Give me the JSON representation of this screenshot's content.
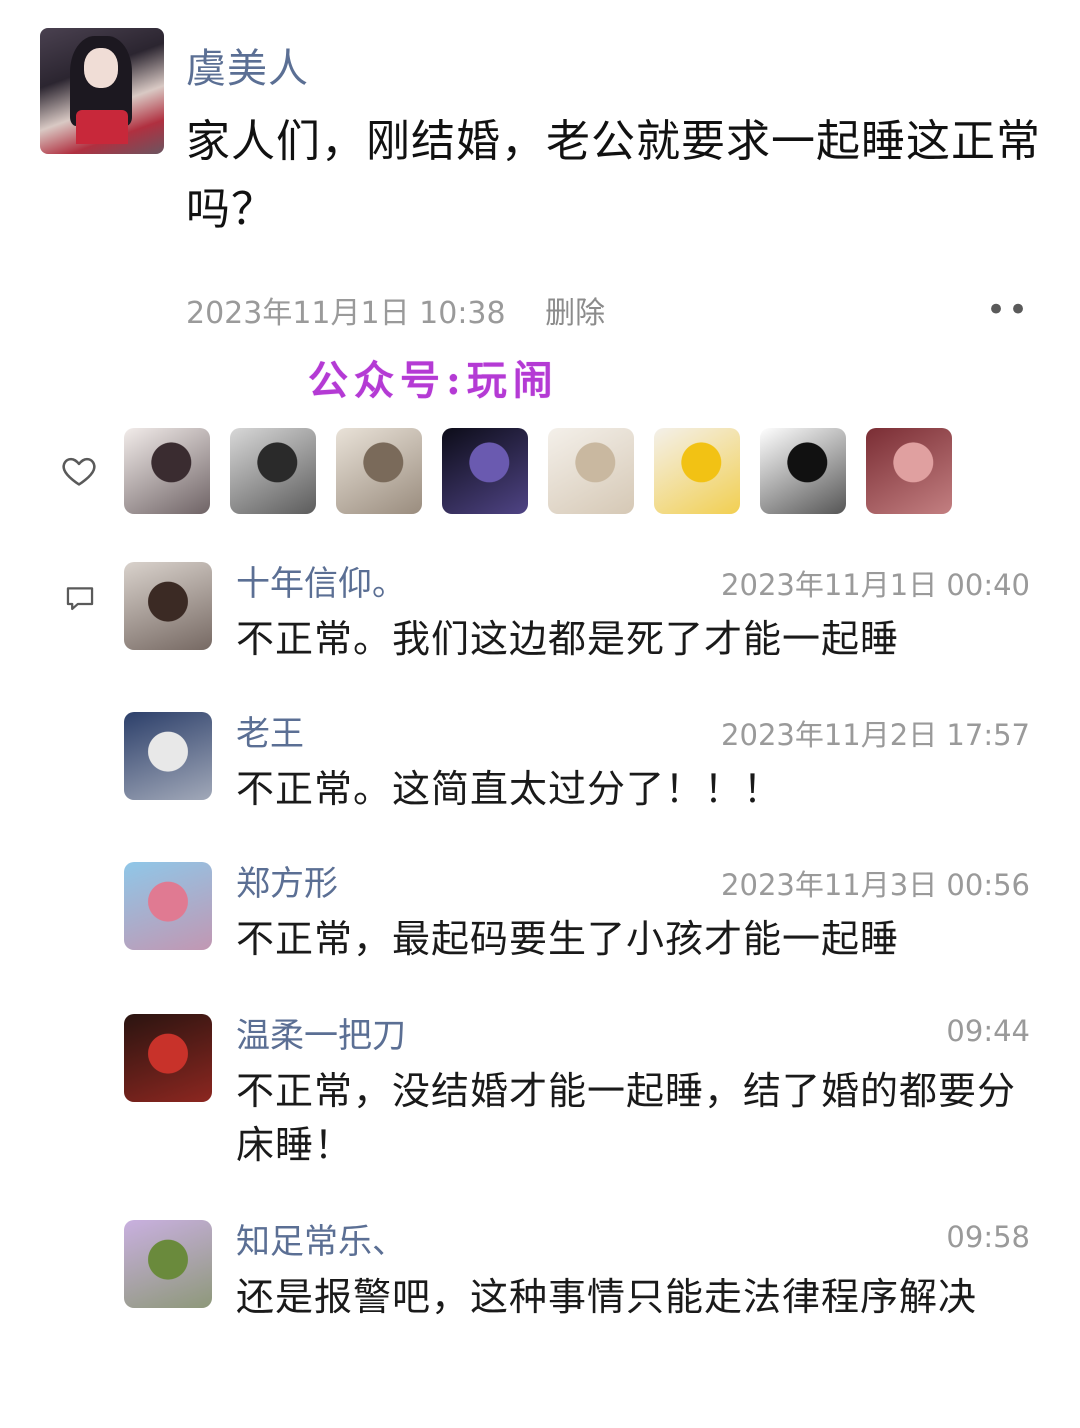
{
  "post": {
    "author": "虞美人",
    "text": "家人们，刚结婚，老公就要求一起睡这正常吗？",
    "timestamp": "2023年11月1日 10:38",
    "delete_label": "删除",
    "more_label": "••"
  },
  "watermark": "公众号:玩闹",
  "likes": {
    "icon": "heart-outline-icon",
    "avatars": [
      {
        "name": "liker-avatar-1",
        "colors": [
          "#f2ecea",
          "#3a2c30"
        ]
      },
      {
        "name": "liker-avatar-2",
        "colors": [
          "#d8d8d8",
          "#2a2a2a"
        ]
      },
      {
        "name": "liker-avatar-3",
        "colors": [
          "#e9e2d8",
          "#7a6a5a"
        ]
      },
      {
        "name": "liker-avatar-4",
        "colors": [
          "#0c0c18",
          "#6a5ab0"
        ]
      },
      {
        "name": "liker-avatar-5",
        "colors": [
          "#f4f0ea",
          "#c9b8a0"
        ]
      },
      {
        "name": "liker-avatar-6",
        "colors": [
          "#f3f0ea",
          "#f2c214"
        ]
      },
      {
        "name": "liker-avatar-7",
        "colors": [
          "#ffffff",
          "#111111"
        ]
      },
      {
        "name": "liker-avatar-8",
        "colors": [
          "#7a2d34",
          "#e0a0a0"
        ]
      }
    ]
  },
  "comments_icon": "comment-bubble-icon",
  "comments": [
    {
      "name": "十年信仰。",
      "time": "2023年11月1日 00:40",
      "text": "不正常。我们这边都是死了才能一起睡",
      "colors": [
        "#d9d2cc",
        "#3b2a24"
      ]
    },
    {
      "name": "老王",
      "time": "2023年11月2日 17:57",
      "text": "不正常。这简直太过分了！！！",
      "colors": [
        "#2c3f6a",
        "#e8e8e8"
      ]
    },
    {
      "name": "郑方形",
      "time": "2023年11月3日 00:56",
      "text": "不正常，最起码要生了小孩才能一起睡",
      "colors": [
        "#8fc7e8",
        "#e07a92"
      ]
    },
    {
      "name": "温柔一把刀",
      "time": "09:44",
      "text": "不正常，没结婚才能一起睡，结了婚的都要分床睡！",
      "colors": [
        "#2a1410",
        "#c8322a"
      ]
    },
    {
      "name": "知足常乐、",
      "time": "09:58",
      "text": "还是报警吧，这种事情只能走法律程序解决",
      "colors": [
        "#c9b0e0",
        "#6a8a3c"
      ]
    }
  ]
}
